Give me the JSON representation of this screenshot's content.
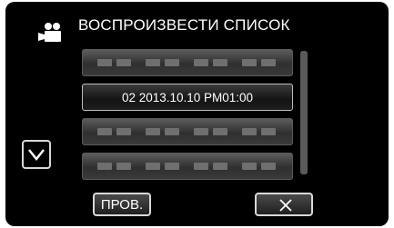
{
  "header": {
    "title": "ВОСПРОИЗВЕСТИ СПИСОК",
    "icon": "camera-icon"
  },
  "playlist": {
    "items": [
      {
        "label": "",
        "state": "blank"
      },
      {
        "label": "02 2013.10.10 PM01:00",
        "state": "selected"
      },
      {
        "label": "",
        "state": "blank"
      },
      {
        "label": "",
        "state": "blank"
      }
    ]
  },
  "controls": {
    "down_icon": "chevron-down-icon",
    "check_label": "ПРОВ.",
    "close_icon": "close-icon"
  },
  "colors": {
    "background": "#000000",
    "text": "#ffffff",
    "button_border": "#d8d8d8"
  }
}
